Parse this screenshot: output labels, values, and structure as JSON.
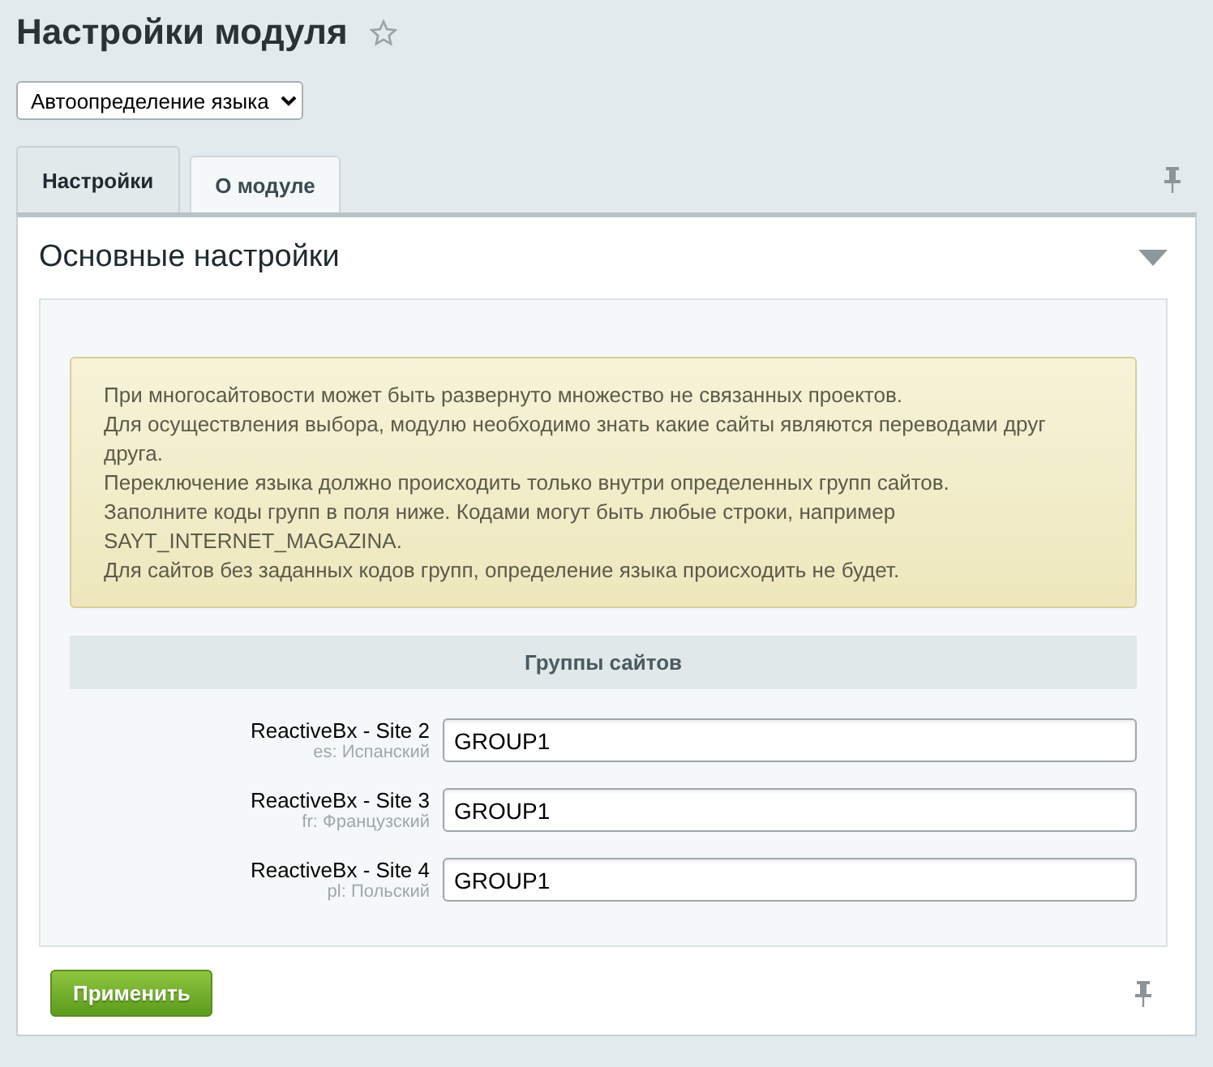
{
  "page": {
    "title": "Настройки модуля",
    "favorite": false
  },
  "module_select": {
    "value": "Автоопределение языка"
  },
  "tabs": [
    {
      "label": "Настройки",
      "selected": true
    },
    {
      "label": "О модуле",
      "selected": false
    }
  ],
  "section": {
    "title": "Основные настройки",
    "expanded": true
  },
  "note": [
    "При многосайтовости может быть развернуто множество не связанных проектов.",
    "Для осуществления выбора, модулю необходимо знать какие сайты являются переводами друг друга.",
    "Переключение языка должно происходить только внутри определенных групп сайтов.",
    "Заполните коды групп в поля ниже. Кодами могут быть любые строки, например SAYT_INTERNET_MAGAZINA.",
    "Для сайтов без заданных кодов групп, определение языка происходить не будет."
  ],
  "group_header": "Группы сайтов",
  "sites": [
    {
      "name": "ReactiveBx - Site 2",
      "language": "es: Испанский",
      "value": "GROUP1"
    },
    {
      "name": "ReactiveBx - Site 3",
      "language": "fr: Французский",
      "value": "GROUP1"
    },
    {
      "name": "ReactiveBx - Site 4",
      "language": "pl: Польский",
      "value": "GROUP1"
    }
  ],
  "apply_button": "Применить"
}
